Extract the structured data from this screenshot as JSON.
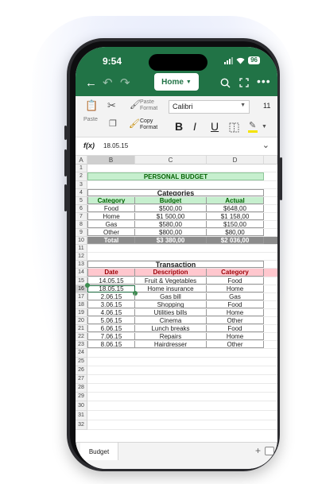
{
  "status_bar": {
    "time": "9:54",
    "battery": "96"
  },
  "toolbar": {
    "back_icon": "back-arrow-icon",
    "undo_icon": "undo-icon",
    "redo_icon": "redo-icon",
    "tab_menu_label": "Home",
    "search_icon": "search-icon",
    "fullscreen_icon": "fullscreen-icon",
    "more_icon": "more-icon",
    "accent": "#217346"
  },
  "ribbon": {
    "paste_label": "Paste",
    "paste_format_label": "Paste Format",
    "copy_format_label": "Copy Format",
    "font_name": "Calibri",
    "font_size": "11",
    "bold": "B",
    "italic": "I",
    "underline": "U"
  },
  "formula_bar": {
    "fx": "f(x)",
    "value": "18.05.15"
  },
  "columns": [
    "A",
    "B",
    "C",
    "D"
  ],
  "row_numbers": [
    "1",
    "2",
    "3",
    "4",
    "5",
    "6",
    "7",
    "8",
    "9",
    "10",
    "11",
    "12",
    "13",
    "14",
    "15",
    "16",
    "17",
    "18",
    "19",
    "20",
    "21",
    "22",
    "23",
    "24",
    "25",
    "26",
    "27",
    "28",
    "29",
    "30",
    "31",
    "32"
  ],
  "sheet": {
    "title": "PERSONAL BUDGET",
    "categories_title": "Categories",
    "categories_headers": [
      "Category",
      "Budget",
      "Actual"
    ],
    "categories_rows": [
      [
        "Food",
        "$500,00",
        "$648,00"
      ],
      [
        "Home",
        "$1 500,00",
        "$1 158,00"
      ],
      [
        "Gas",
        "$580,00",
        "$150,00"
      ],
      [
        "Other",
        "$800,00",
        "$80,00"
      ]
    ],
    "categories_total": [
      "Total",
      "$3 380,00",
      "$2 036,00"
    ],
    "transaction_title": "Transaction",
    "transaction_headers": [
      "Date",
      "Description",
      "Category"
    ],
    "transaction_rows": [
      [
        "14.05.15",
        "Fruit & Vegetables",
        "Food"
      ],
      [
        "18.05.15",
        "Home insurance",
        "Home"
      ],
      [
        "2.06.15",
        "Gas bill",
        "Gas"
      ],
      [
        "3.06.15",
        "Shopping",
        "Food"
      ],
      [
        "4.06.15",
        "Utilities bills",
        "Home"
      ],
      [
        "5.06.15",
        "Cinema",
        "Other"
      ],
      [
        "6.06.15",
        "Lunch breaks",
        "Food"
      ],
      [
        "7.06.15",
        "Repairs",
        "Home"
      ],
      [
        "8.06.15",
        "Hairdresser",
        "Other"
      ]
    ]
  },
  "sheet_tabs": [
    "Budget"
  ],
  "selected_cell": "B16"
}
